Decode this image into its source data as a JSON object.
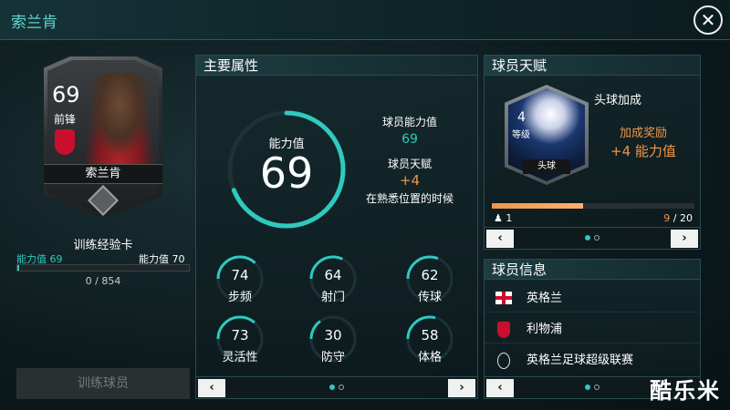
{
  "header": {
    "title": "索兰肯"
  },
  "player_card": {
    "rating": "69",
    "position": "前锋",
    "name": "索兰肯"
  },
  "training": {
    "card_label": "训练经验卡",
    "ability_left_label": "能力值",
    "ability_left_value": "69",
    "ability_right_label": "能力值",
    "ability_right_value": "70",
    "progress_text": "0 / 854",
    "progress_fraction": 0,
    "button_label": "训练球员"
  },
  "main_attributes": {
    "title": "主要属性",
    "overall_label": "能力值",
    "overall_value": "69",
    "player_ability_label": "球员能力值",
    "player_ability_value": "69",
    "talent_label": "球员天赋",
    "talent_bonus": "+4",
    "talent_desc": "在熟悉位置的时候",
    "stats": [
      {
        "name": "步频",
        "value": "74"
      },
      {
        "name": "射门",
        "value": "64"
      },
      {
        "name": "传球",
        "value": "62"
      },
      {
        "name": "灵活性",
        "value": "73"
      },
      {
        "name": "防守",
        "value": "30"
      },
      {
        "name": "体格",
        "value": "58"
      }
    ]
  },
  "talent": {
    "title": "球员天赋",
    "skill_name": "头球加成",
    "level": "4",
    "level_label": "等级",
    "tag": "头球",
    "bonus_label": "加成奖励",
    "bonus_value": "+4 能力值",
    "progress_left": "1",
    "progress_current": "9",
    "progress_total": "20",
    "progress_fraction": 0.45
  },
  "player_info": {
    "title": "球员信息",
    "nation": "英格兰",
    "club": "利物浦",
    "league": "英格兰足球超级联赛"
  },
  "watermark": "酷乐米",
  "colors": {
    "accent": "#2fc9c0",
    "highlight": "#f0954a"
  }
}
